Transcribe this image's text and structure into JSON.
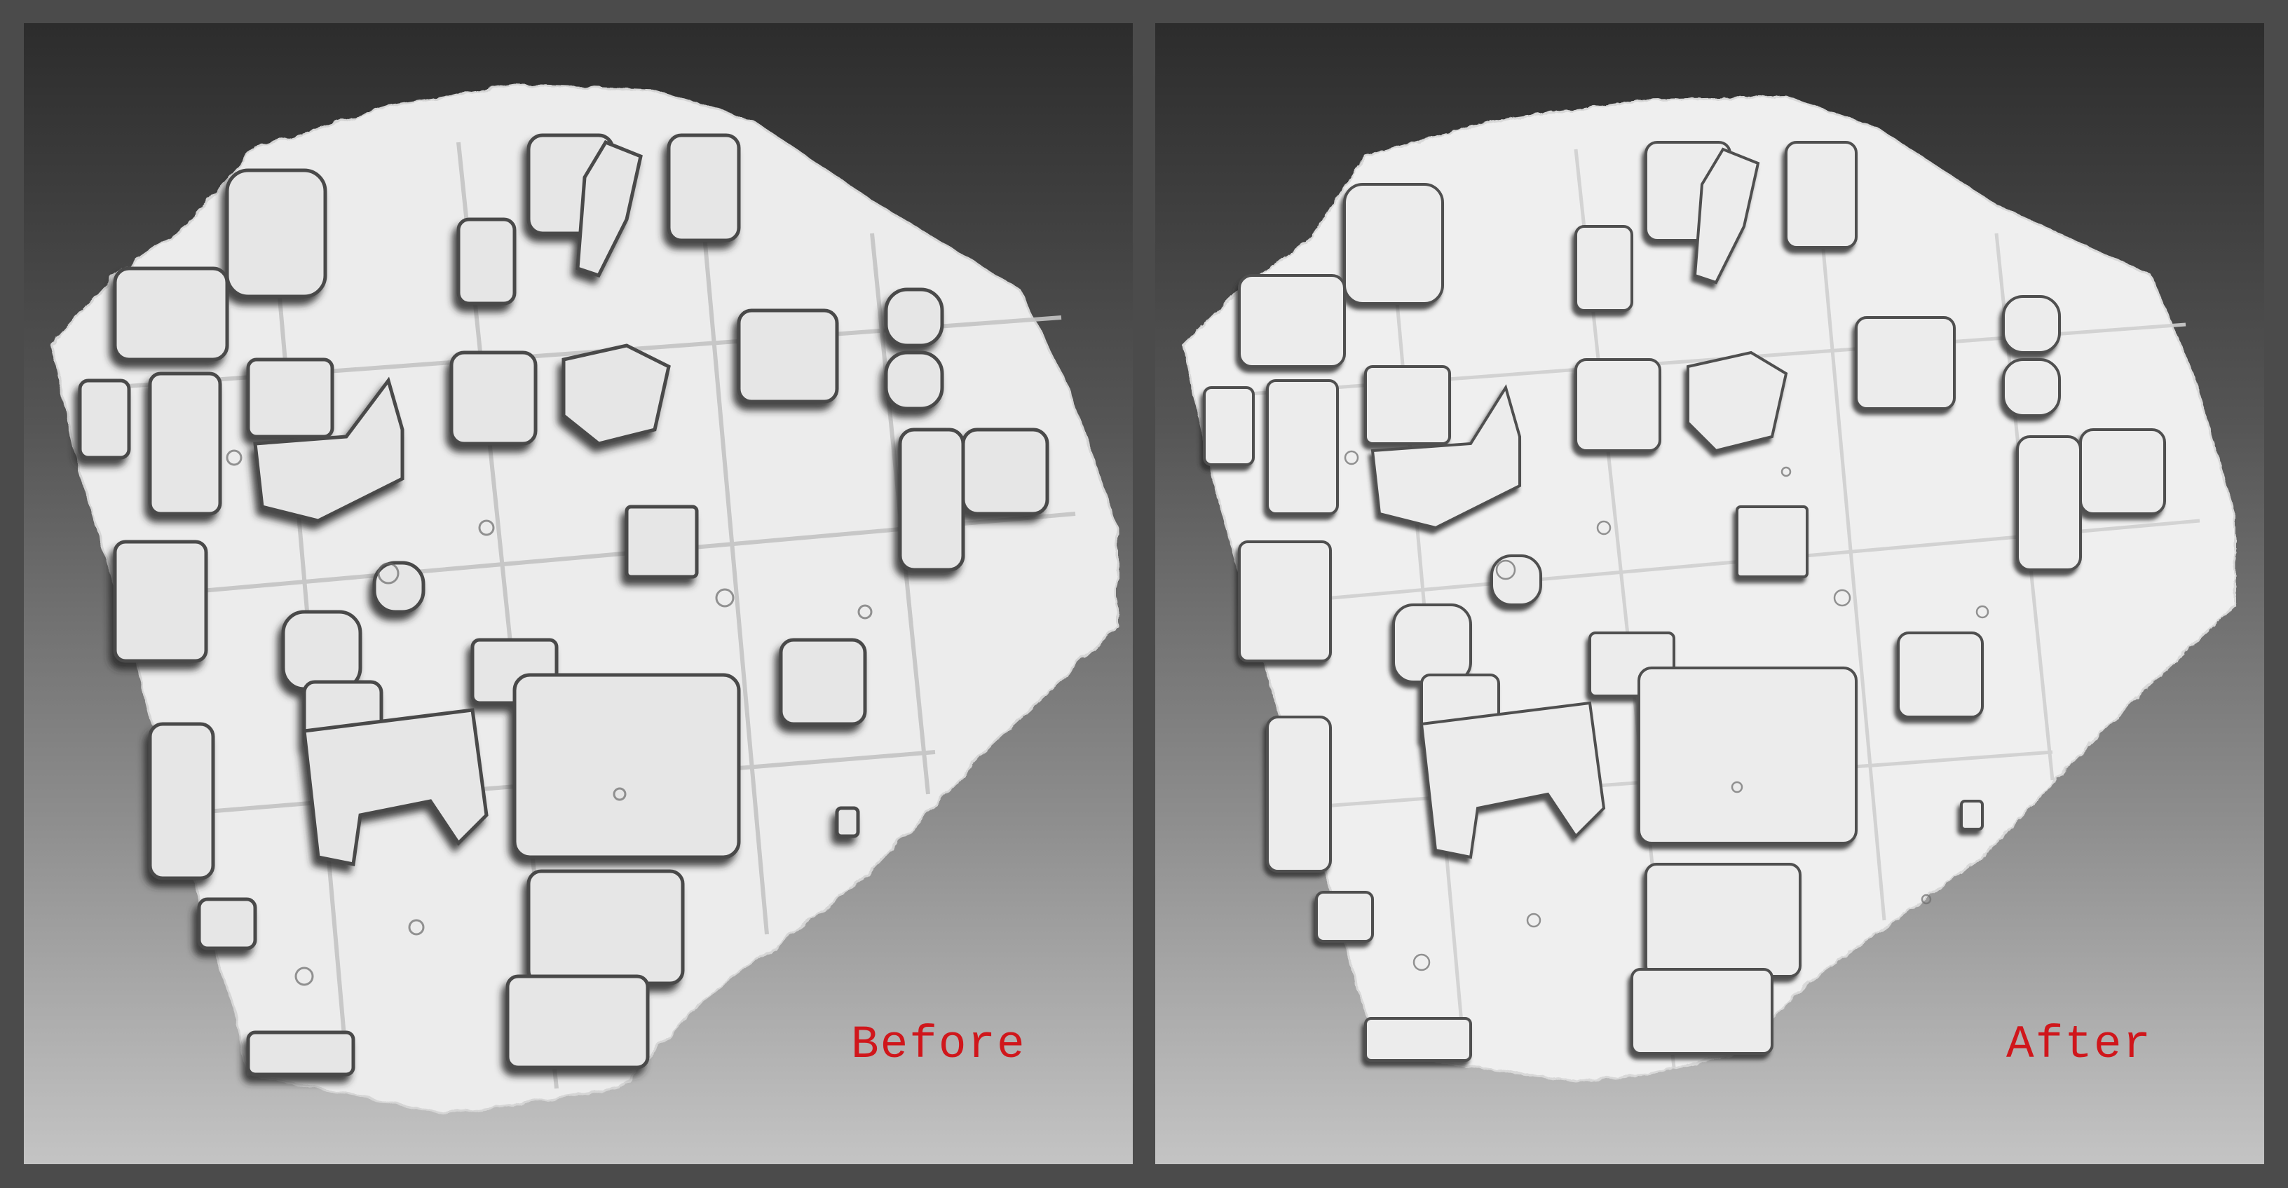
{
  "panels": {
    "before": {
      "label": "Before"
    },
    "after": {
      "label": "After"
    }
  },
  "colors": {
    "label": "#d0161b",
    "frame": "#4b4b4b",
    "mesh_surface": "#ececec",
    "mesh_shadow": "#3a3a3a"
  }
}
